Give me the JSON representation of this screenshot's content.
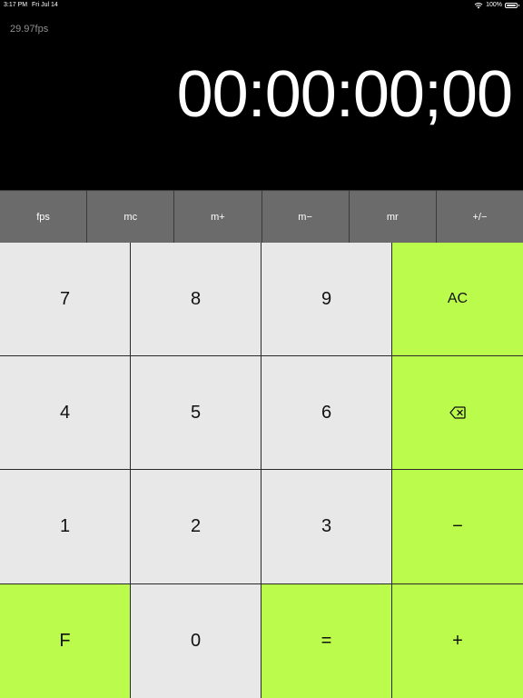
{
  "status_bar": {
    "time": "3:17 PM",
    "date": "Fri Jul 14",
    "battery": "100%"
  },
  "display": {
    "fps": "29.97fps",
    "timecode": "00:00:00;00"
  },
  "function_row": [
    "fps",
    "mc",
    "m+",
    "m−",
    "mr",
    "+/−"
  ],
  "keys": {
    "k7": "7",
    "k8": "8",
    "k9": "9",
    "ac": "AC",
    "k4": "4",
    "k5": "5",
    "k6": "6",
    "k1": "1",
    "k2": "2",
    "k3": "3",
    "minus": "−",
    "f": "F",
    "k0": "0",
    "equals": "=",
    "plus": "+"
  },
  "colors": {
    "accent_green": "#bbfb4b",
    "digit_key": "#e8e8e8",
    "function_row": "#6b6b6b",
    "background": "#000000"
  }
}
